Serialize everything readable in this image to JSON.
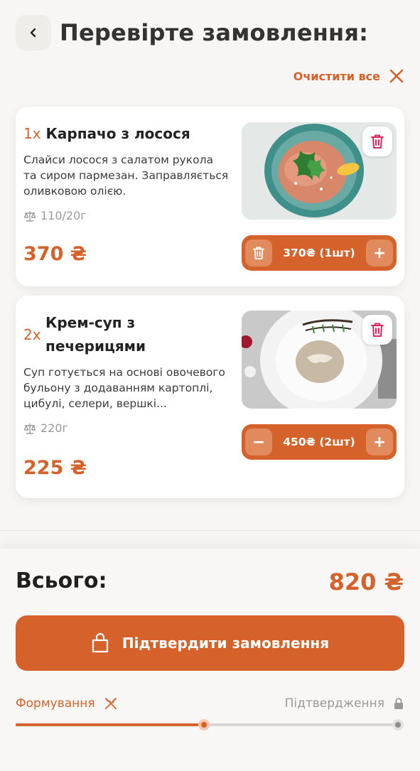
{
  "header": {
    "title": "Перевірте замовлення:",
    "back_icon": "chevron-left-icon"
  },
  "clear_all": {
    "label": "Очистити все",
    "icon": "close-icon"
  },
  "items": [
    {
      "qty": "1x",
      "name": "Карпачо з лосося",
      "description": "Слайси лосося з салатом рукола та сиром пармезан. Заправляється оливковою олією.",
      "weight": "110/20г",
      "price": "370 ₴",
      "stepper_value": "370₴ (1шт)",
      "left_button": "trash-icon",
      "right_button": "+"
    },
    {
      "qty": "2x",
      "name": "Крем-суп з печерицями",
      "description": "Суп готується на основі овочевого бульону з додаванням картоплі, цибулі, селери, вершкі...",
      "weight": "220г",
      "price": "225 ₴",
      "stepper_value": "450₴ (2шт)",
      "left_button": "−",
      "right_button": "+"
    }
  ],
  "summary": {
    "total_label": "Всього:",
    "total_value": "820 ₴"
  },
  "confirm": {
    "label": "Підтвердити замовлення",
    "icon": "bag-icon"
  },
  "progress": {
    "step1": "Формування",
    "step2": "Підтвердження",
    "fraction": 0.49
  },
  "colors": {
    "accent": "#d4622a",
    "delete": "#e0245e"
  }
}
